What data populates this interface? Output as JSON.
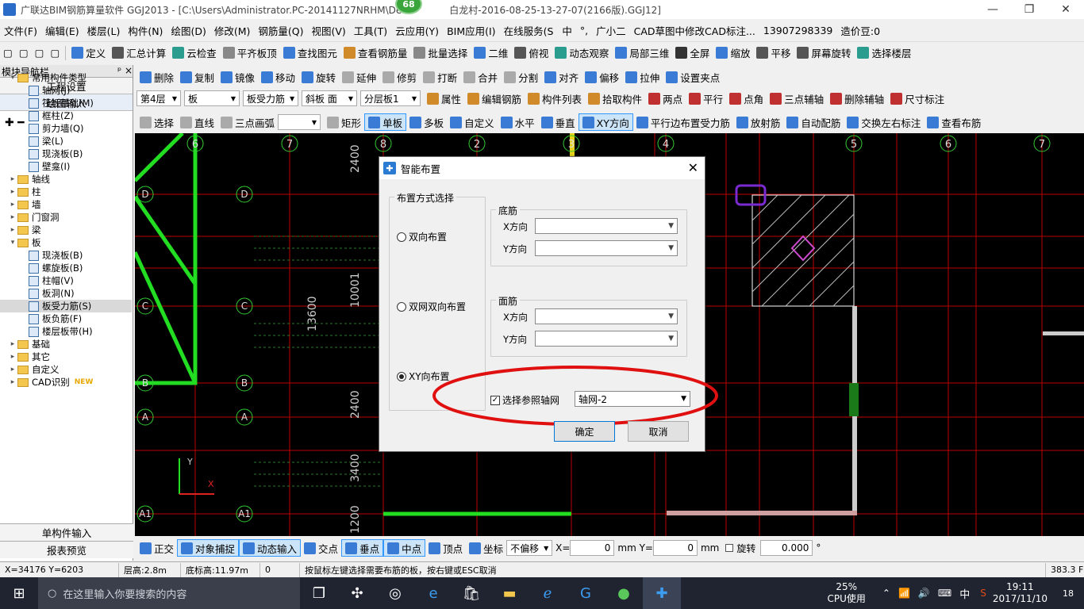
{
  "window": {
    "title": "广联达BIM钢筋算量软件 GGJ2013 - [C:\\Users\\Administrator.PC-20141127NRHM\\De",
    "title_tail": "白龙村-2016-08-25-13-27-07(2166版).GGJ12]",
    "badge": "68",
    "min": "—",
    "max": "❐",
    "close": "✕"
  },
  "menu": [
    "文件(F)",
    "编辑(E)",
    "楼层(L)",
    "构件(N)",
    "绘图(D)",
    "修改(M)",
    "钢筋量(Q)",
    "视图(V)",
    "工具(T)",
    "云应用(Y)",
    "BIM应用(I)",
    "在线服务(S"
  ],
  "menu_right": {
    "ime": "中",
    "ime_mode": "°,",
    "helper": "广小二",
    "cad": "CAD草图中修改CAD标注...",
    "phone": "13907298339",
    "price": "造价豆:0"
  },
  "toolbar1": [
    "定义",
    "汇总计算",
    "云检查",
    "平齐板顶",
    "查找图元",
    "查看钢筋量",
    "批量选择",
    "二维",
    "俯视",
    "动态观察",
    "局部三维",
    "全屏",
    "缩放",
    "平移",
    "屏幕旋转",
    "选择楼层"
  ],
  "panel": {
    "title": "模块导航栏",
    "pin": "ᵖ ×",
    "btn1": "工程设置",
    "btn2": "绘图输入",
    "bottom1": "单构件输入",
    "bottom2": "报表预览"
  },
  "tree": [
    {
      "t": "常用构件类型",
      "lvl": 0,
      "kind": "folder",
      "exp": "−"
    },
    {
      "t": "轴网(J)",
      "lvl": 1,
      "kind": "leaf"
    },
    {
      "t": "筏板基础(M)",
      "lvl": 1,
      "kind": "leaf"
    },
    {
      "t": "框柱(Z)",
      "lvl": 1,
      "kind": "leaf"
    },
    {
      "t": "剪力墙(Q)",
      "lvl": 1,
      "kind": "leaf"
    },
    {
      "t": "梁(L)",
      "lvl": 1,
      "kind": "leaf"
    },
    {
      "t": "现浇板(B)",
      "lvl": 1,
      "kind": "leaf"
    },
    {
      "t": "壁龛(I)",
      "lvl": 1,
      "kind": "leaf"
    },
    {
      "t": "轴线",
      "lvl": 0,
      "kind": "folder",
      "exp": "+"
    },
    {
      "t": "柱",
      "lvl": 0,
      "kind": "folder",
      "exp": "+"
    },
    {
      "t": "墙",
      "lvl": 0,
      "kind": "folder",
      "exp": "+"
    },
    {
      "t": "门窗洞",
      "lvl": 0,
      "kind": "folder",
      "exp": "+"
    },
    {
      "t": "梁",
      "lvl": 0,
      "kind": "folder",
      "exp": "+"
    },
    {
      "t": "板",
      "lvl": 0,
      "kind": "folder",
      "exp": "−"
    },
    {
      "t": "现浇板(B)",
      "lvl": 1,
      "kind": "leaf"
    },
    {
      "t": "螺旋板(B)",
      "lvl": 1,
      "kind": "leaf"
    },
    {
      "t": "柱帽(V)",
      "lvl": 1,
      "kind": "leaf"
    },
    {
      "t": "板洞(N)",
      "lvl": 1,
      "kind": "leaf"
    },
    {
      "t": "板受力筋(S)",
      "lvl": 1,
      "kind": "leaf",
      "sel": true
    },
    {
      "t": "板负筋(F)",
      "lvl": 1,
      "kind": "leaf"
    },
    {
      "t": "楼层板带(H)",
      "lvl": 1,
      "kind": "leaf"
    },
    {
      "t": "基础",
      "lvl": 0,
      "kind": "folder",
      "exp": "+"
    },
    {
      "t": "其它",
      "lvl": 0,
      "kind": "folder",
      "exp": "+"
    },
    {
      "t": "自定义",
      "lvl": 0,
      "kind": "folder",
      "exp": "+"
    },
    {
      "t": "CAD识别",
      "lvl": 0,
      "kind": "folder",
      "exp": "+",
      "badge": "NEW"
    }
  ],
  "toolbar2": [
    "删除",
    "复制",
    "镜像",
    "移动",
    "旋转",
    "延伸",
    "修剪",
    "打断",
    "合并",
    "分割",
    "对齐",
    "偏移",
    "拉伸",
    "设置夹点"
  ],
  "toolbar3": {
    "floor": "第4层",
    "type": "板",
    "sub": "板受力筋",
    "item1": "斜板 面",
    "item2": "分层板1",
    "btns": [
      "属性",
      "编辑钢筋",
      "构件列表",
      "拾取构件",
      "两点",
      "平行",
      "点角",
      "三点辅轴",
      "删除辅轴",
      "尺寸标注"
    ]
  },
  "toolbar4": [
    "选择",
    "直线",
    "三点画弧",
    "矩形",
    "单板",
    "多板",
    "自定义",
    "水平",
    "垂直",
    "XY方向",
    "平行边布置受力筋",
    "放射筋",
    "自动配筋",
    "交换左右标注",
    "查看布筋"
  ],
  "canvas": {
    "axis_top": [
      "6",
      "7",
      "8",
      "2",
      "3",
      "4",
      "5",
      "6",
      "7"
    ],
    "axis_left": [
      "D",
      "D",
      "C",
      "C",
      "B",
      "B",
      "A",
      "A",
      "A1",
      "A1"
    ],
    "dims": [
      "2400",
      "10001",
      "13600",
      "2400",
      "3400",
      "1200"
    ]
  },
  "dialog": {
    "title": "智能布置",
    "mode_group": "布置方式选择",
    "opt1": "双向布置",
    "opt2": "双网双向布置",
    "opt3": "XY向布置",
    "bottom_group": "底筋",
    "top_group": "面筋",
    "x_label": "X方向",
    "y_label": "Y方向",
    "ref_check": "选择参照轴网",
    "ref_value": "轴网-2",
    "ok": "确定",
    "cancel": "取消"
  },
  "statusbar": {
    "items": [
      "正交",
      "对象捕捉",
      "动态输入",
      "交点",
      "垂点",
      "中点",
      "顶点",
      "坐标"
    ],
    "offset": "不偏移",
    "x_label": "X=",
    "x_value": "0",
    "y_label": "mm Y=",
    "y_value": "0",
    "unit": "mm",
    "rotate_label": "旋转",
    "rotate_value": "0.000",
    "deg": "°"
  },
  "infobar": {
    "coords": "X=34176 Y=6203",
    "floor_h": "层高:2.8m",
    "base_h": "底标高:11.97m",
    "zero": "0",
    "msg": "按鼠标左键选择需要布筋的板，按右键或ESC取消",
    "fps": "383.3 FPS"
  },
  "taskbar": {
    "search": "在这里输入你要搜索的内容",
    "cpu_pct": "25%",
    "cpu": "CPU使用",
    "ime": "中",
    "time": "19:11",
    "date": "2017/11/10",
    "notif": "18"
  }
}
